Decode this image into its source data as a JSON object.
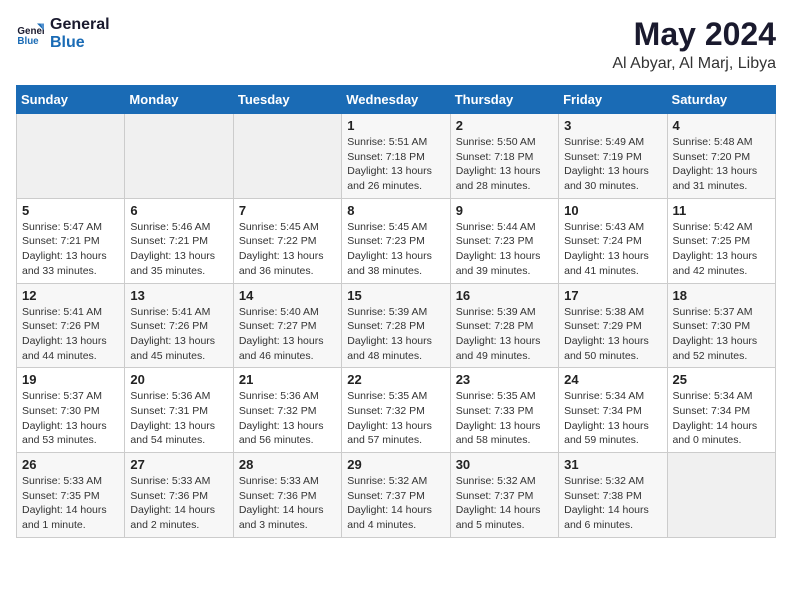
{
  "logo": {
    "line1": "General",
    "line2": "Blue"
  },
  "title": "May 2024",
  "location": "Al Abyar, Al Marj, Libya",
  "weekdays": [
    "Sunday",
    "Monday",
    "Tuesday",
    "Wednesday",
    "Thursday",
    "Friday",
    "Saturday"
  ],
  "weeks": [
    [
      {
        "day": "",
        "sunrise": "",
        "sunset": "",
        "daylight": ""
      },
      {
        "day": "",
        "sunrise": "",
        "sunset": "",
        "daylight": ""
      },
      {
        "day": "",
        "sunrise": "",
        "sunset": "",
        "daylight": ""
      },
      {
        "day": "1",
        "sunrise": "Sunrise: 5:51 AM",
        "sunset": "Sunset: 7:18 PM",
        "daylight": "Daylight: 13 hours and 26 minutes."
      },
      {
        "day": "2",
        "sunrise": "Sunrise: 5:50 AM",
        "sunset": "Sunset: 7:18 PM",
        "daylight": "Daylight: 13 hours and 28 minutes."
      },
      {
        "day": "3",
        "sunrise": "Sunrise: 5:49 AM",
        "sunset": "Sunset: 7:19 PM",
        "daylight": "Daylight: 13 hours and 30 minutes."
      },
      {
        "day": "4",
        "sunrise": "Sunrise: 5:48 AM",
        "sunset": "Sunset: 7:20 PM",
        "daylight": "Daylight: 13 hours and 31 minutes."
      }
    ],
    [
      {
        "day": "5",
        "sunrise": "Sunrise: 5:47 AM",
        "sunset": "Sunset: 7:21 PM",
        "daylight": "Daylight: 13 hours and 33 minutes."
      },
      {
        "day": "6",
        "sunrise": "Sunrise: 5:46 AM",
        "sunset": "Sunset: 7:21 PM",
        "daylight": "Daylight: 13 hours and 35 minutes."
      },
      {
        "day": "7",
        "sunrise": "Sunrise: 5:45 AM",
        "sunset": "Sunset: 7:22 PM",
        "daylight": "Daylight: 13 hours and 36 minutes."
      },
      {
        "day": "8",
        "sunrise": "Sunrise: 5:45 AM",
        "sunset": "Sunset: 7:23 PM",
        "daylight": "Daylight: 13 hours and 38 minutes."
      },
      {
        "day": "9",
        "sunrise": "Sunrise: 5:44 AM",
        "sunset": "Sunset: 7:23 PM",
        "daylight": "Daylight: 13 hours and 39 minutes."
      },
      {
        "day": "10",
        "sunrise": "Sunrise: 5:43 AM",
        "sunset": "Sunset: 7:24 PM",
        "daylight": "Daylight: 13 hours and 41 minutes."
      },
      {
        "day": "11",
        "sunrise": "Sunrise: 5:42 AM",
        "sunset": "Sunset: 7:25 PM",
        "daylight": "Daylight: 13 hours and 42 minutes."
      }
    ],
    [
      {
        "day": "12",
        "sunrise": "Sunrise: 5:41 AM",
        "sunset": "Sunset: 7:26 PM",
        "daylight": "Daylight: 13 hours and 44 minutes."
      },
      {
        "day": "13",
        "sunrise": "Sunrise: 5:41 AM",
        "sunset": "Sunset: 7:26 PM",
        "daylight": "Daylight: 13 hours and 45 minutes."
      },
      {
        "day": "14",
        "sunrise": "Sunrise: 5:40 AM",
        "sunset": "Sunset: 7:27 PM",
        "daylight": "Daylight: 13 hours and 46 minutes."
      },
      {
        "day": "15",
        "sunrise": "Sunrise: 5:39 AM",
        "sunset": "Sunset: 7:28 PM",
        "daylight": "Daylight: 13 hours and 48 minutes."
      },
      {
        "day": "16",
        "sunrise": "Sunrise: 5:39 AM",
        "sunset": "Sunset: 7:28 PM",
        "daylight": "Daylight: 13 hours and 49 minutes."
      },
      {
        "day": "17",
        "sunrise": "Sunrise: 5:38 AM",
        "sunset": "Sunset: 7:29 PM",
        "daylight": "Daylight: 13 hours and 50 minutes."
      },
      {
        "day": "18",
        "sunrise": "Sunrise: 5:37 AM",
        "sunset": "Sunset: 7:30 PM",
        "daylight": "Daylight: 13 hours and 52 minutes."
      }
    ],
    [
      {
        "day": "19",
        "sunrise": "Sunrise: 5:37 AM",
        "sunset": "Sunset: 7:30 PM",
        "daylight": "Daylight: 13 hours and 53 minutes."
      },
      {
        "day": "20",
        "sunrise": "Sunrise: 5:36 AM",
        "sunset": "Sunset: 7:31 PM",
        "daylight": "Daylight: 13 hours and 54 minutes."
      },
      {
        "day": "21",
        "sunrise": "Sunrise: 5:36 AM",
        "sunset": "Sunset: 7:32 PM",
        "daylight": "Daylight: 13 hours and 56 minutes."
      },
      {
        "day": "22",
        "sunrise": "Sunrise: 5:35 AM",
        "sunset": "Sunset: 7:32 PM",
        "daylight": "Daylight: 13 hours and 57 minutes."
      },
      {
        "day": "23",
        "sunrise": "Sunrise: 5:35 AM",
        "sunset": "Sunset: 7:33 PM",
        "daylight": "Daylight: 13 hours and 58 minutes."
      },
      {
        "day": "24",
        "sunrise": "Sunrise: 5:34 AM",
        "sunset": "Sunset: 7:34 PM",
        "daylight": "Daylight: 13 hours and 59 minutes."
      },
      {
        "day": "25",
        "sunrise": "Sunrise: 5:34 AM",
        "sunset": "Sunset: 7:34 PM",
        "daylight": "Daylight: 14 hours and 0 minutes."
      }
    ],
    [
      {
        "day": "26",
        "sunrise": "Sunrise: 5:33 AM",
        "sunset": "Sunset: 7:35 PM",
        "daylight": "Daylight: 14 hours and 1 minute."
      },
      {
        "day": "27",
        "sunrise": "Sunrise: 5:33 AM",
        "sunset": "Sunset: 7:36 PM",
        "daylight": "Daylight: 14 hours and 2 minutes."
      },
      {
        "day": "28",
        "sunrise": "Sunrise: 5:33 AM",
        "sunset": "Sunset: 7:36 PM",
        "daylight": "Daylight: 14 hours and 3 minutes."
      },
      {
        "day": "29",
        "sunrise": "Sunrise: 5:32 AM",
        "sunset": "Sunset: 7:37 PM",
        "daylight": "Daylight: 14 hours and 4 minutes."
      },
      {
        "day": "30",
        "sunrise": "Sunrise: 5:32 AM",
        "sunset": "Sunset: 7:37 PM",
        "daylight": "Daylight: 14 hours and 5 minutes."
      },
      {
        "day": "31",
        "sunrise": "Sunrise: 5:32 AM",
        "sunset": "Sunset: 7:38 PM",
        "daylight": "Daylight: 14 hours and 6 minutes."
      },
      {
        "day": "",
        "sunrise": "",
        "sunset": "",
        "daylight": ""
      }
    ]
  ]
}
